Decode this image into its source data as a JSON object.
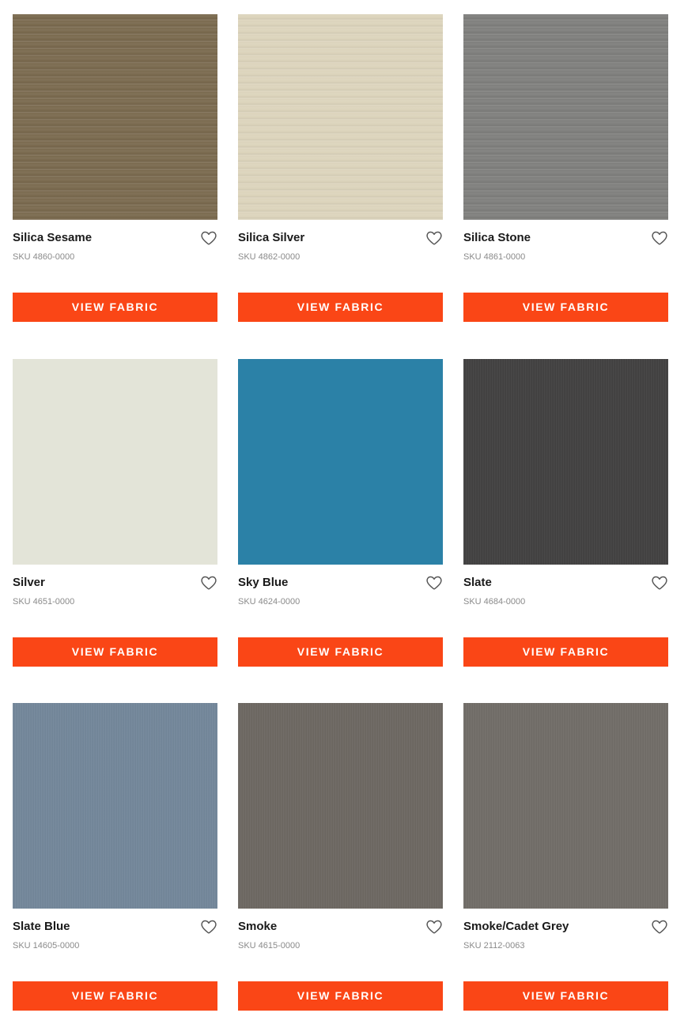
{
  "button_color": "#fa4616",
  "fabrics": [
    {
      "name": "Silica Sesame",
      "sku": "SKU 4860-0000",
      "color": "#7a6a4f",
      "texture": "silica",
      "button": "VIEW FABRIC",
      "favorite_icon": "heart-outline-icon"
    },
    {
      "name": "Silica Silver",
      "sku": "SKU 4862-0000",
      "color": "#dcd4bc",
      "texture": "silica",
      "button": "VIEW FABRIC",
      "favorite_icon": "heart-outline-icon"
    },
    {
      "name": "Silica Stone",
      "sku": "SKU 4861-0000",
      "color": "#7f7f7d",
      "texture": "silica",
      "button": "VIEW FABRIC",
      "favorite_icon": "heart-outline-icon"
    },
    {
      "name": "Silver",
      "sku": "SKU 4651-0000",
      "color": "#e3e4d8",
      "texture": "plain",
      "button": "VIEW FABRIC",
      "favorite_icon": "heart-outline-icon"
    },
    {
      "name": "Sky Blue",
      "sku": "SKU 4624-0000",
      "color": "#2b81a7",
      "texture": "plain",
      "button": "VIEW FABRIC",
      "favorite_icon": "heart-outline-icon"
    },
    {
      "name": "Slate",
      "sku": "SKU 4684-0000",
      "color": "#424141",
      "texture": "woven",
      "button": "VIEW FABRIC",
      "favorite_icon": "heart-outline-icon"
    },
    {
      "name": "Slate Blue",
      "sku": "SKU 14605-0000",
      "color": "#73879a",
      "texture": "woven",
      "button": "VIEW FABRIC",
      "favorite_icon": "heart-outline-icon"
    },
    {
      "name": "Smoke",
      "sku": "SKU 4615-0000",
      "color": "#6d6862",
      "texture": "woven",
      "button": "VIEW FABRIC",
      "favorite_icon": "heart-outline-icon"
    },
    {
      "name": "Smoke/Cadet Grey",
      "sku": "SKU 2112-0063",
      "color": "#716d68",
      "texture": "woven",
      "button": "VIEW FABRIC",
      "favorite_icon": "heart-outline-icon"
    }
  ]
}
